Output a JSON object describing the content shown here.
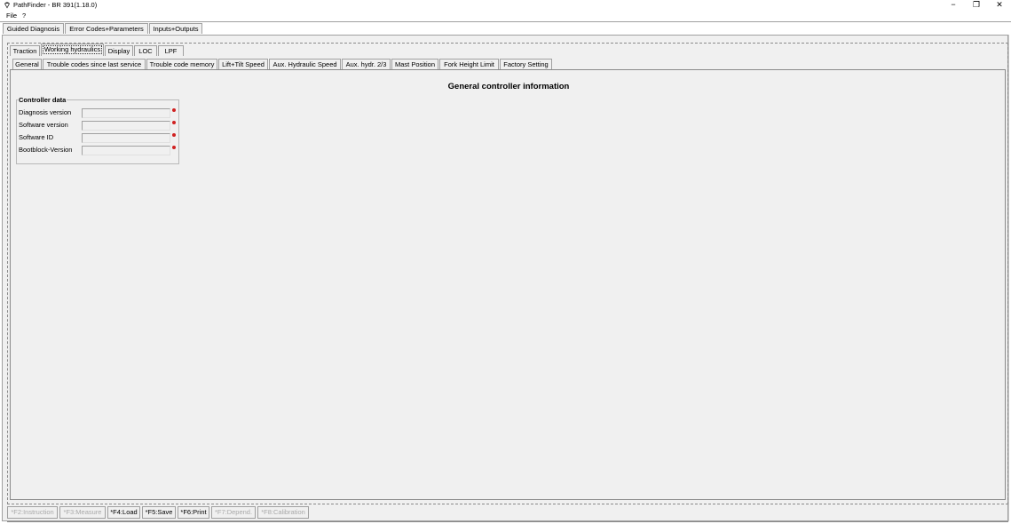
{
  "window": {
    "title": "PathFinder - BR 391(1.18.0)",
    "controls": {
      "minimize": "−",
      "restore": "❐",
      "close": "✕"
    }
  },
  "menu": {
    "items": [
      "File",
      "?"
    ]
  },
  "top_tabs": [
    "Guided Diagnosis",
    "Error Codes+Parameters",
    "Inputs+Outputs"
  ],
  "top_tabs_active": "Error Codes+Parameters",
  "group_tabs": [
    "Traction",
    "Working hydraulics",
    "Display",
    "LOC",
    "LPF"
  ],
  "group_tabs_selected": "Working hydraulics",
  "func_tabs": [
    "General",
    "Trouble codes since last service",
    "Trouble code memory",
    "Lift+Tilt Speed",
    "Aux. Hydraulic Speed",
    "Aux. hydr. 2/3",
    "Mast Position",
    "Fork Height Limit",
    "Factory Setting"
  ],
  "func_tabs_active": "General",
  "content": {
    "heading": "General controller information",
    "group_title": "Controller data",
    "fields": [
      {
        "label": "Diagnosis version",
        "value": ""
      },
      {
        "label": "Software version",
        "value": ""
      },
      {
        "label": "Software ID",
        "value": ""
      },
      {
        "label": "Bootblock-Version",
        "value": ""
      }
    ]
  },
  "bottom_buttons": [
    {
      "label": "*F2:Instruction",
      "enabled": false
    },
    {
      "label": "*F3:Measure",
      "enabled": false
    },
    {
      "label": "*F4:Load",
      "enabled": true
    },
    {
      "label": "*F5:Save",
      "enabled": true
    },
    {
      "label": "*F6:Print",
      "enabled": true
    },
    {
      "label": "*F7:Depend.",
      "enabled": false
    },
    {
      "label": "*F8:Calibration",
      "enabled": false
    }
  ],
  "colors": {
    "panel": "#f0f0f0",
    "border": "#a0a0a0",
    "indicator": "#d02020"
  }
}
